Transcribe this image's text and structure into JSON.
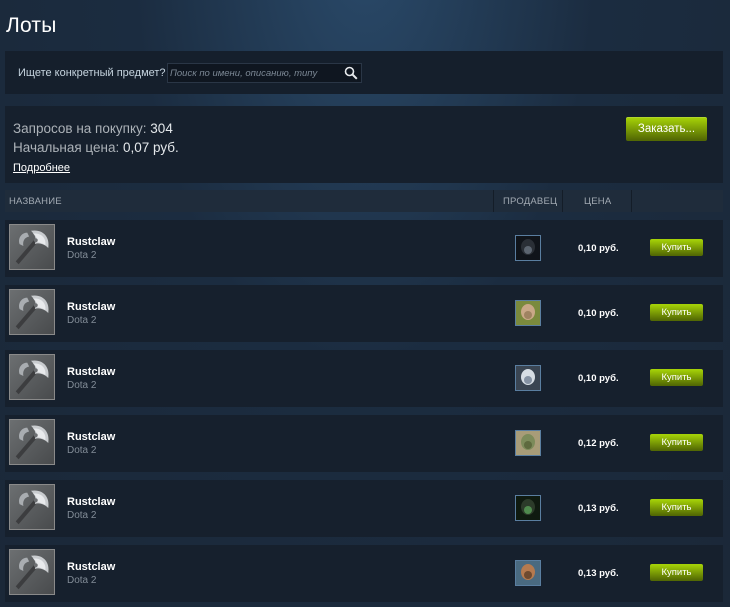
{
  "page": {
    "title": "Лоты"
  },
  "search": {
    "label": "Ищете конкретный предмет?",
    "placeholder": "Поиск по имени, описанию, типу"
  },
  "buy_orders": {
    "requests_label": "Запросов на покупку:",
    "requests_value": "304",
    "start_price_label": "Начальная цена:",
    "start_price_value": "0,07 руб.",
    "details_link": "Подробнее",
    "order_button": "Заказать..."
  },
  "table": {
    "headers": {
      "name": "НАЗВАНИЕ",
      "seller": "ПРОДАВЕЦ",
      "price": "ЦЕНА"
    },
    "rows": [
      {
        "name": "Rustclaw",
        "game": "Dota 2",
        "price": "0,10 руб.",
        "buy": "Купить",
        "avatar_colors": [
          "#2a2f36",
          "#5c6570",
          "#10141a"
        ]
      },
      {
        "name": "Rustclaw",
        "game": "Dota 2",
        "price": "0,10 руб.",
        "buy": "Купить",
        "avatar_colors": [
          "#c9a887",
          "#9f8361",
          "#7a8a3d"
        ]
      },
      {
        "name": "Rustclaw",
        "game": "Dota 2",
        "price": "0,10 руб.",
        "buy": "Купить",
        "avatar_colors": [
          "#d6dde4",
          "#8592a3",
          "#3a4552"
        ]
      },
      {
        "name": "Rustclaw",
        "game": "Dota 2",
        "price": "0,12 руб.",
        "buy": "Купить",
        "avatar_colors": [
          "#7c8b5a",
          "#5e6a3e",
          "#a89c78"
        ]
      },
      {
        "name": "Rustclaw",
        "game": "Dota 2",
        "price": "0,13 руб.",
        "buy": "Купить",
        "avatar_colors": [
          "#2c3b2a",
          "#4f8a4e",
          "#0f1a10"
        ]
      },
      {
        "name": "Rustclaw",
        "game": "Dota 2",
        "price": "0,13 руб.",
        "buy": "Купить",
        "avatar_colors": [
          "#b57a4f",
          "#6e4a30",
          "#4a6a80"
        ]
      }
    ]
  },
  "colors": {
    "accent_button_top": "#a4d007",
    "accent_button_bottom": "#536904",
    "panel_bg": "#16202d",
    "page_bg": "#1b2838"
  }
}
